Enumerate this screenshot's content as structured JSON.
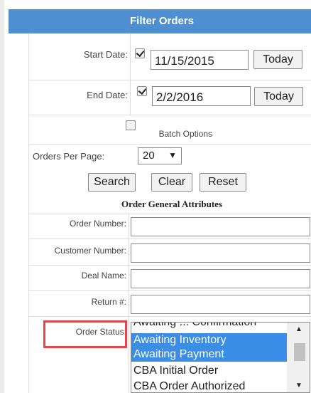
{
  "header": {
    "title": "Filter Orders"
  },
  "start_date": {
    "label": "Start Date:",
    "checked": true,
    "value": "11/15/2015",
    "today_label": "Today"
  },
  "end_date": {
    "label": "End Date:",
    "checked": true,
    "value": "2/2/2016",
    "today_label": "Today"
  },
  "batch": {
    "label": "Batch Options",
    "checked": false
  },
  "per_page": {
    "label": "Orders Per Page:",
    "value": "20",
    "arrow": "▼"
  },
  "actions": {
    "search": "Search",
    "clear": "Clear",
    "reset": "Reset"
  },
  "section": {
    "title": "Order General Attributes"
  },
  "fields": {
    "order_number": "Order Number:",
    "customer_number": "Customer Number:",
    "deal_name": "Deal Name:",
    "return_number": "Return #:"
  },
  "order_status": {
    "label": "Order Status:",
    "options": [
      {
        "text": "Awaiting ... Confirmation",
        "selected": false
      },
      {
        "text": "Awaiting Inventory",
        "selected": true
      },
      {
        "text": "Awaiting Payment",
        "selected": true
      },
      {
        "text": "CBA Initial Order",
        "selected": false
      },
      {
        "text": "CBA Order Authorized",
        "selected": false
      }
    ],
    "scroll_up": "▲",
    "scroll_down": "▼"
  },
  "colors": {
    "header": "#4e8fd2",
    "selection": "#3b8ee6",
    "highlight": "#e0484d"
  }
}
